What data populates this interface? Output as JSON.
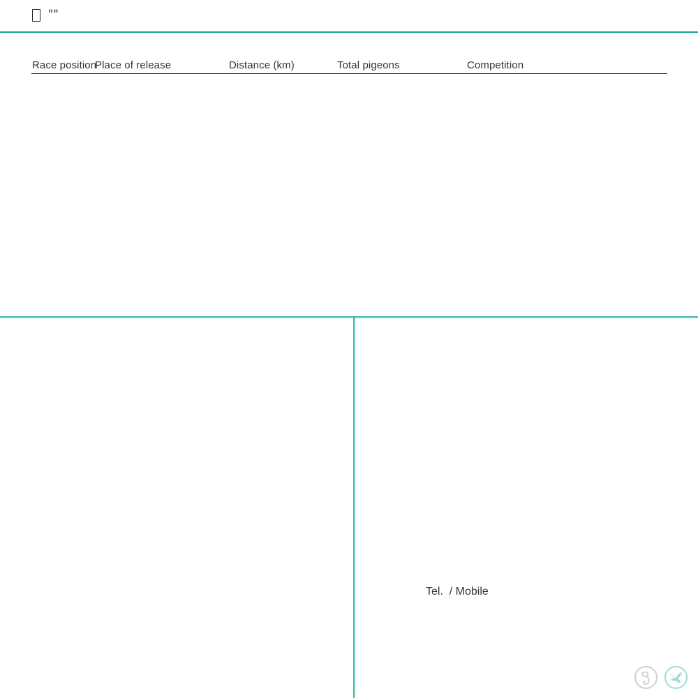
{
  "header": {
    "icon": "document-icon",
    "title": "\"\""
  },
  "table": {
    "columns": [
      "Race position",
      "Place of release",
      "Distance (km)",
      "Total pigeons",
      "Competition"
    ],
    "rows": []
  },
  "contact": {
    "label": "Tel.  / Mobile"
  },
  "footer_icons": [
    {
      "name": "logo-circle-icon",
      "color": "#cfcfcf"
    },
    {
      "name": "pigeon-icon",
      "color": "#9fdcd6"
    }
  ],
  "colors": {
    "accent": "#17a398"
  }
}
